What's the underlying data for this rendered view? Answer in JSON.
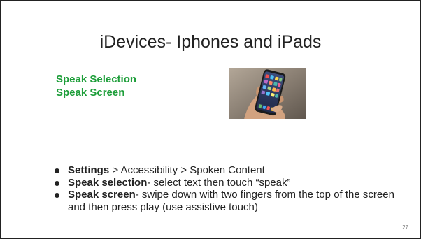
{
  "slide": {
    "title": "iDevices- Iphones and iPads",
    "subheadings": [
      "Speak Selection",
      "Speak Screen"
    ],
    "bullets": [
      {
        "bold": "Settings",
        "text": " > Accessibility > Spoken Content"
      },
      {
        "bold": "Speak selection",
        "text": "- select text then touch “speak”"
      },
      {
        "bold": "Speak screen",
        "text": "- swipe down with two fingers from the top of the screen and then press play (use assistive touch)"
      }
    ],
    "page_number": "27",
    "colors": {
      "subheading": "#1e9e3a",
      "text": "#222222"
    },
    "image_icon": "hand-holding-phone-photo"
  }
}
